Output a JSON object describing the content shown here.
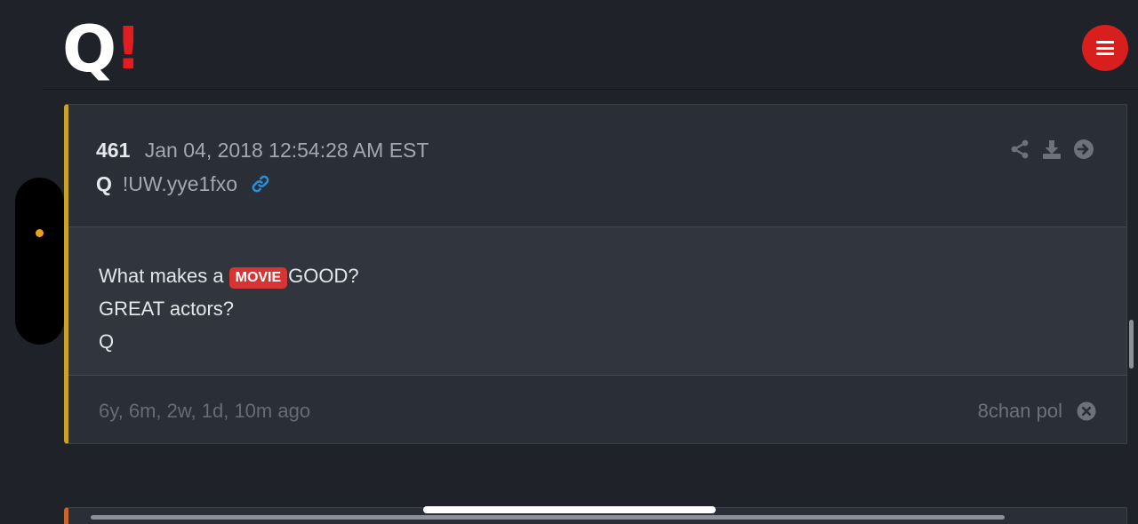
{
  "header": {
    "logo_text": "Q",
    "logo_mark": "!",
    "menu_icon": "hamburger-menu-icon"
  },
  "post": {
    "number": "461",
    "date": "Jan 04, 2018 12:54:28 AM EST",
    "author": "Q",
    "tripcode": "!UW.yye1fxo",
    "link_icon": "link-icon",
    "actions": [
      "share-icon",
      "download-icon",
      "arrow-right-circle-icon"
    ],
    "body": {
      "line1_before": "What makes a",
      "tag": "MOVIE",
      "line1_after": "GOOD?",
      "line2": "GREAT actors?",
      "line3": "Q"
    },
    "ago": "6y, 6m, 2w, 1d, 10m ago",
    "source": "8chan pol",
    "close_icon": "close-circle-icon"
  },
  "colors": {
    "background": "#1f2228",
    "card": "#2a2e36",
    "accent_gold": "#c9a227",
    "accent_red": "#d91e1e",
    "tag_red": "#d73535",
    "link_blue": "#2a8fd8"
  }
}
